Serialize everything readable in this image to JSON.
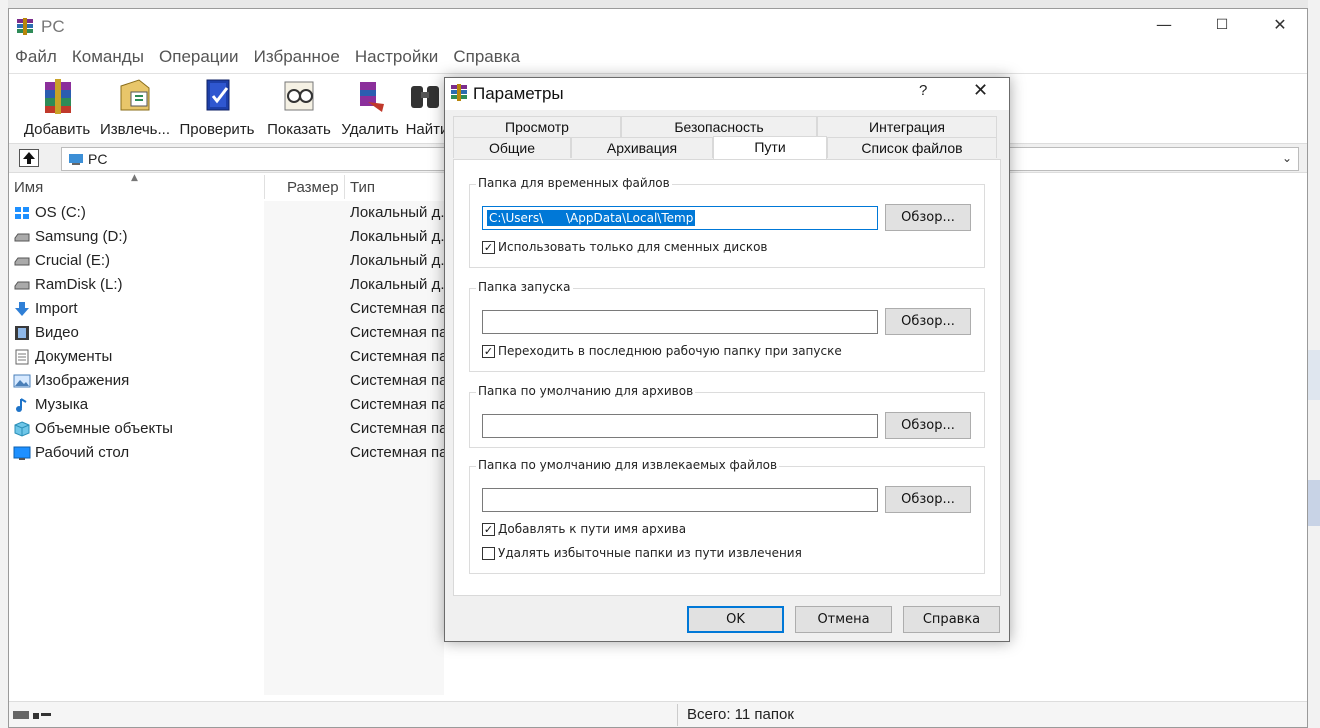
{
  "window": {
    "title": "PC",
    "min": "—",
    "max": "☐",
    "close": "✕"
  },
  "menu": [
    "Файл",
    "Команды",
    "Операции",
    "Избранное",
    "Настройки",
    "Справка"
  ],
  "toolbar": [
    {
      "label": "Добавить",
      "icon": "add-archive-icon"
    },
    {
      "label": "Извлечь...",
      "icon": "extract-icon"
    },
    {
      "label": "Проверить",
      "icon": "test-icon"
    },
    {
      "label": "Показать",
      "icon": "view-icon"
    },
    {
      "label": "Удалить",
      "icon": "delete-icon"
    },
    {
      "label": "Найти",
      "icon": "find-icon"
    }
  ],
  "address": {
    "value": "PC"
  },
  "columns": {
    "name": "Имя",
    "size": "Размер",
    "type": "Тип"
  },
  "files": [
    {
      "name": "OS (C:)",
      "type": "Локальный д...",
      "icon": "windows-drive-icon"
    },
    {
      "name": "Samsung (D:)",
      "type": "Локальный д...",
      "icon": "drive-icon"
    },
    {
      "name": "Crucial (E:)",
      "type": "Локальный д...",
      "icon": "drive-icon"
    },
    {
      "name": "RamDisk (L:)",
      "type": "Локальный д...",
      "icon": "drive-icon"
    },
    {
      "name": "Import",
      "type": "Системная папка",
      "icon": "download-icon"
    },
    {
      "name": "Видео",
      "type": "Системная папка",
      "icon": "video-icon"
    },
    {
      "name": "Документы",
      "type": "Системная папка",
      "icon": "documents-icon"
    },
    {
      "name": "Изображения",
      "type": "Системная папка",
      "icon": "pictures-icon"
    },
    {
      "name": "Музыка",
      "type": "Системная папка",
      "icon": "music-icon"
    },
    {
      "name": "Объемные объекты",
      "type": "Системная папка",
      "icon": "3d-objects-icon"
    },
    {
      "name": "Рабочий стол",
      "type": "Системная папка",
      "icon": "desktop-icon"
    }
  ],
  "status": {
    "text": "Всего: 11 папок"
  },
  "dialog": {
    "title": "Параметры",
    "help": "?",
    "close": "✕",
    "tabs_row1": [
      "Просмотр",
      "Безопасность",
      "Интеграция"
    ],
    "tabs_row2": [
      "Общие",
      "Архивация",
      "Пути",
      "Список файлов"
    ],
    "active_tab": "Пути",
    "groups": {
      "temp": {
        "label": "Папка для временных файлов",
        "value": "C:\\Users\\      \\AppData\\Local\\Temp",
        "browse": "Обзор...",
        "checkbox": {
          "label": "Использовать только для сменных дисков",
          "checked": true
        }
      },
      "startup": {
        "label": "Папка запуска",
        "value": "",
        "browse": "Обзор...",
        "checkbox": {
          "label": "Переходить в последнюю рабочую папку при запуске",
          "checked": true
        }
      },
      "default_archives": {
        "label": "Папка по умолчанию для архивов",
        "value": "",
        "browse": "Обзор..."
      },
      "default_extract": {
        "label": "Папка по умолчанию для извлекаемых файлов",
        "value": "",
        "browse": "Обзор...",
        "checkbox1": {
          "label": "Добавлять к пути имя архива",
          "checked": true
        },
        "checkbox2": {
          "label": "Удалять избыточные папки из пути извлечения",
          "checked": false
        }
      }
    },
    "buttons": {
      "ok": "OK",
      "cancel": "Отмена",
      "help": "Справка"
    }
  },
  "colors": {
    "accent": "#0078d7",
    "dialog_bg": "#f0f0f0"
  }
}
